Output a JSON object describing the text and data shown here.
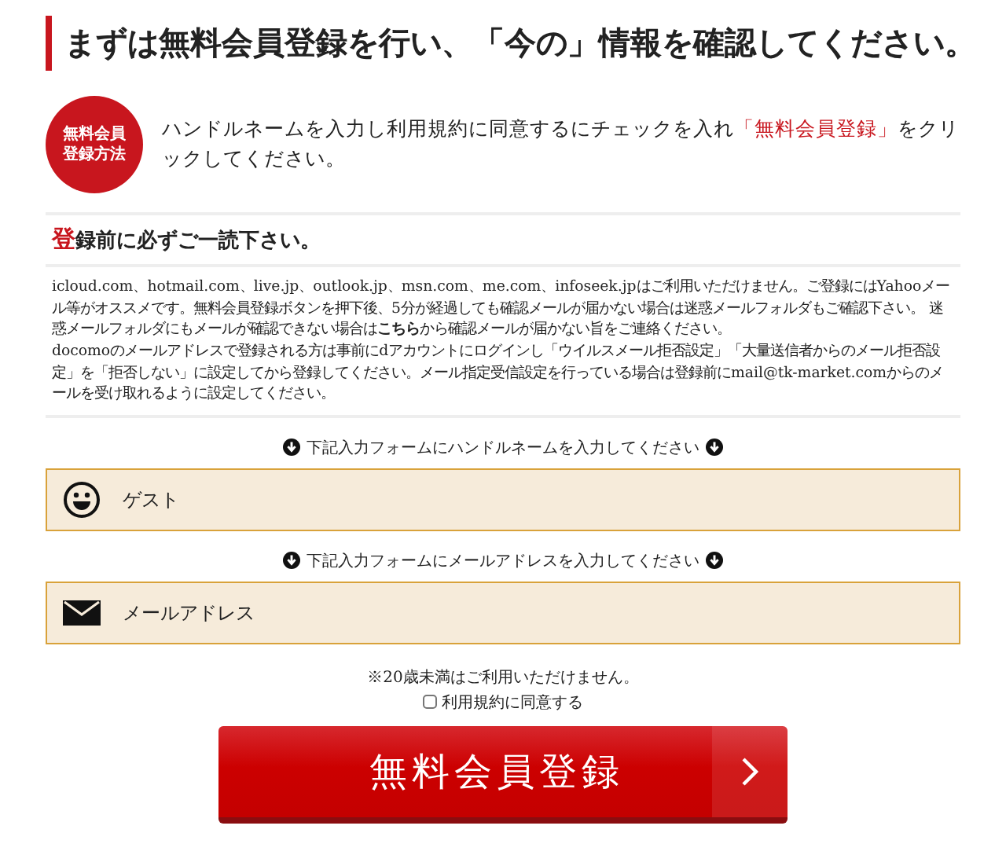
{
  "title": "まずは無料会員登録を行い、「今の」情報を確認してください。",
  "howto": {
    "badge": [
      "無料会員",
      "登録方法"
    ],
    "text": [
      {
        "kind": "plain",
        "text": "ハンドルネームを入力し利用規約に同意するにチェックを入れ"
      },
      {
        "kind": "highlight",
        "text": "「無料会員登録」"
      },
      {
        "kind": "plain",
        "text": "をクリックしてください。"
      }
    ]
  },
  "notice": {
    "heading": [
      {
        "kind": "highlight",
        "text": "登"
      },
      {
        "kind": "plain",
        "text": "録前に必ずご一読下さい。"
      }
    ],
    "paragraphs": [
      "icloud.com、hotmail.com、live.jp、outlook.jp、msn.com、me.com、infoseek.jpはご利用いただけません。ご登録にはYahooメール等がオススメです。無料会員登録ボタンを押下後、5分が経過しても確認メールが届かない場合は迷惑メールフォルダもご確認下さい。 迷惑メールフォルダにもメールが確認できない場合は**こちら**から確認メールが届かない旨をご連絡ください。",
      "docomoのメールアドレスで登録される方は事前にdアカウントにログインし「ウイルスメール拒否設定」「大量送信者からのメール拒否設定」を「拒否しない」に設定してから登録してください。メール指定受信設定を行っている場合は登録前にmail@tk-market.comからのメールを受け取れるように設定してください。"
    ]
  },
  "fields": [
    {
      "kind": "name",
      "hint": "下記入力フォームにハンドルネームを入力してください",
      "placeholder": "ゲスト"
    },
    {
      "kind": "email",
      "hint": "下記入力フォームにメールアドレスを入力してください",
      "placeholder": "メールアドレス"
    }
  ],
  "age_note": "※20歳未満はご利用いただけません。",
  "agree": {
    "label": "利用規約に同意する",
    "checked": false
  },
  "submit": "無料会員登録"
}
